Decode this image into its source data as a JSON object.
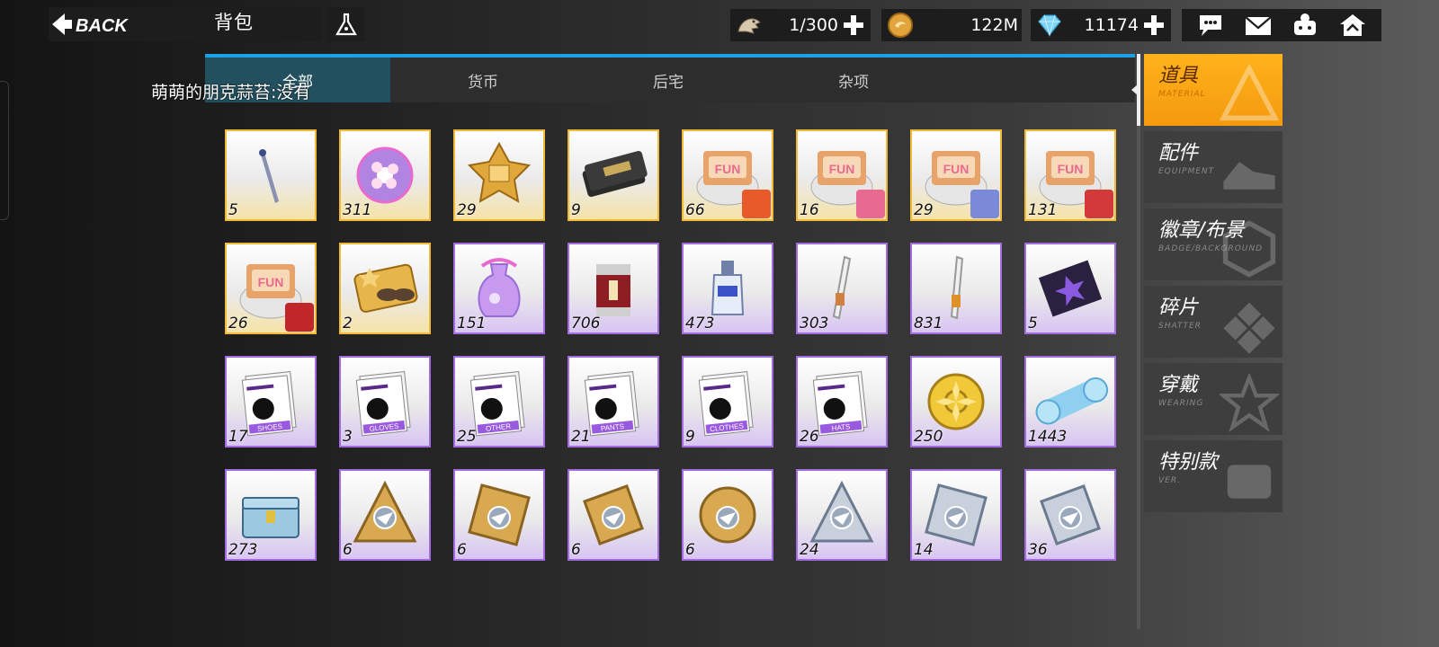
{
  "header": {
    "back_label": "BACK",
    "title": "背包"
  },
  "resources": [
    {
      "icon": "fossil-icon",
      "value": "1/300"
    },
    {
      "icon": "gold-coin-icon",
      "value": "122M"
    },
    {
      "icon": "diamond-icon",
      "value": "11174"
    }
  ],
  "tabs": [
    "全部",
    "货币",
    "后宅",
    "杂项"
  ],
  "active_tab": 0,
  "notice": "萌萌的朋克蒜苔:没有",
  "categories": [
    {
      "zh": "道具",
      "en": "MATERIAL"
    },
    {
      "zh": "配件",
      "en": "EQUIPMENT"
    },
    {
      "zh": "徽章/布景",
      "en": "BADGE/BACKGROUND"
    },
    {
      "zh": "碎片",
      "en": "SHATTER"
    },
    {
      "zh": "穿戴",
      "en": "WEARING"
    },
    {
      "zh": "特别款",
      "en": "VER."
    }
  ],
  "items": [
    {
      "count": "5",
      "rarity": "gold",
      "icon": "pen-icon"
    },
    {
      "count": "311",
      "rarity": "gold",
      "icon": "flower-orb-icon"
    },
    {
      "count": "29",
      "rarity": "gold",
      "icon": "gold-star-chest-icon"
    },
    {
      "count": "9",
      "rarity": "gold",
      "icon": "ticket-stack-icon"
    },
    {
      "count": "66",
      "rarity": "gold",
      "icon": "fun-food-icon",
      "badge": "#e85a2a"
    },
    {
      "count": "16",
      "rarity": "gold",
      "icon": "fun-food-icon",
      "badge": "#e86a90"
    },
    {
      "count": "29",
      "rarity": "gold",
      "icon": "fun-food-icon",
      "badge": "#7a8ad8"
    },
    {
      "count": "131",
      "rarity": "gold",
      "icon": "fun-food-icon",
      "badge": "#d23a3a"
    },
    {
      "count": "26",
      "rarity": "gold",
      "icon": "fun-food-icon",
      "badge": "#c0262a"
    },
    {
      "count": "2",
      "rarity": "gold",
      "icon": "gold-card-icon"
    },
    {
      "count": "151",
      "rarity": "purple",
      "icon": "potion-bottle-icon"
    },
    {
      "count": "706",
      "rarity": "purple",
      "icon": "red-canister-icon"
    },
    {
      "count": "473",
      "rarity": "purple",
      "icon": "blue-vial-icon"
    },
    {
      "count": "303",
      "rarity": "purple",
      "icon": "tube-icon"
    },
    {
      "count": "831",
      "rarity": "purple",
      "icon": "glue-tube-icon"
    },
    {
      "count": "5",
      "rarity": "purple",
      "icon": "badge-scroll-icon"
    },
    {
      "count": "17",
      "rarity": "purple",
      "icon": "shoes-manual-icon",
      "label": "SHOES"
    },
    {
      "count": "3",
      "rarity": "purple",
      "icon": "gloves-manual-icon",
      "label": "GLOVES"
    },
    {
      "count": "25",
      "rarity": "purple",
      "icon": "other-manual-icon",
      "label": "OTHER"
    },
    {
      "count": "21",
      "rarity": "purple",
      "icon": "pants-manual-icon",
      "label": "PANTS"
    },
    {
      "count": "9",
      "rarity": "purple",
      "icon": "clothes-manual-icon",
      "label": "CLOTHES"
    },
    {
      "count": "26",
      "rarity": "purple",
      "icon": "hats-manual-icon",
      "label": "HATS"
    },
    {
      "count": "250",
      "rarity": "purple",
      "icon": "gold-medal-icon"
    },
    {
      "count": "1443",
      "rarity": "purple",
      "icon": "blue-scroll-icon"
    },
    {
      "count": "273",
      "rarity": "purple",
      "icon": "crate-icon"
    },
    {
      "count": "6",
      "rarity": "purple",
      "icon": "triangle-emblem-icon"
    },
    {
      "count": "6",
      "rarity": "purple",
      "icon": "square-emblem-icon"
    },
    {
      "count": "6",
      "rarity": "purple",
      "icon": "diamond-emblem-icon"
    },
    {
      "count": "6",
      "rarity": "purple",
      "icon": "round-emblem-icon"
    },
    {
      "count": "24",
      "rarity": "purple",
      "icon": "triangle-emblem-silver-icon"
    },
    {
      "count": "14",
      "rarity": "purple",
      "icon": "square-emblem-silver-icon"
    },
    {
      "count": "36",
      "rarity": "purple",
      "icon": "diamond-emblem-silver-icon"
    }
  ],
  "colors": {
    "accent": "#1da1e4",
    "gold_frame": "#f0b93a",
    "purple_frame": "#a26bdf",
    "active_category": "#ffb21b"
  }
}
